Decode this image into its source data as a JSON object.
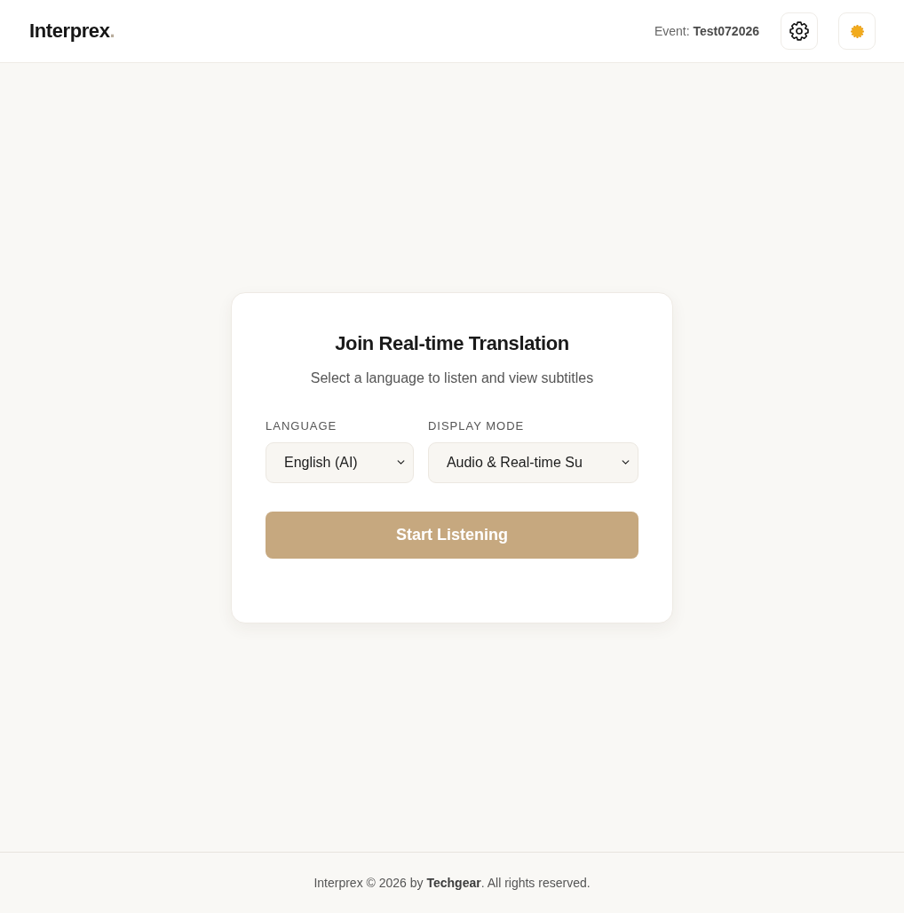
{
  "header": {
    "logo": {
      "text": "Interprex",
      "dot": "."
    },
    "event": "Event: **Test072026**",
    "buttons": [
      {
        "kind": "settings"
      },
      {
        "kind": "theme"
      }
    ]
  },
  "card": {
    "title": "Join Real-time Translation",
    "subtitle": "Select a language to listen and view subtitles",
    "fields": [
      {
        "label": "LANGUAGE",
        "value": "English (AI)"
      },
      {
        "label": "DISPLAY MODE",
        "value": "Audio & Real-time Su"
      }
    ],
    "button": "Start Listening"
  },
  "footer": {
    "text": "Interprex © 2026 by **Techgear**. All rights reserved."
  }
}
